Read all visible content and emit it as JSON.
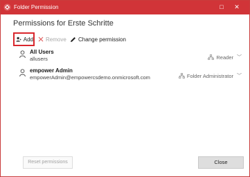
{
  "window": {
    "title": "Folder Permission",
    "minimize_glyph": "□",
    "close_glyph": "✕"
  },
  "heading": "Permissions for Erste Schritte",
  "toolbar": {
    "add_label": "Add",
    "remove_label": "Remove",
    "change_label": "Change permission"
  },
  "users": [
    {
      "name": "All Users",
      "sub": "allusers",
      "permission": "Reader"
    },
    {
      "name": "empower Admin",
      "sub": "empowerAdmin@empowercsdemo.onmicrosoft.com",
      "permission": "Folder Administrator"
    }
  ],
  "footer": {
    "reset_label": "Reset permissions",
    "close_label": "Close"
  },
  "colors": {
    "titlebar": "#d13438",
    "add_highlight": "#d9262c"
  }
}
